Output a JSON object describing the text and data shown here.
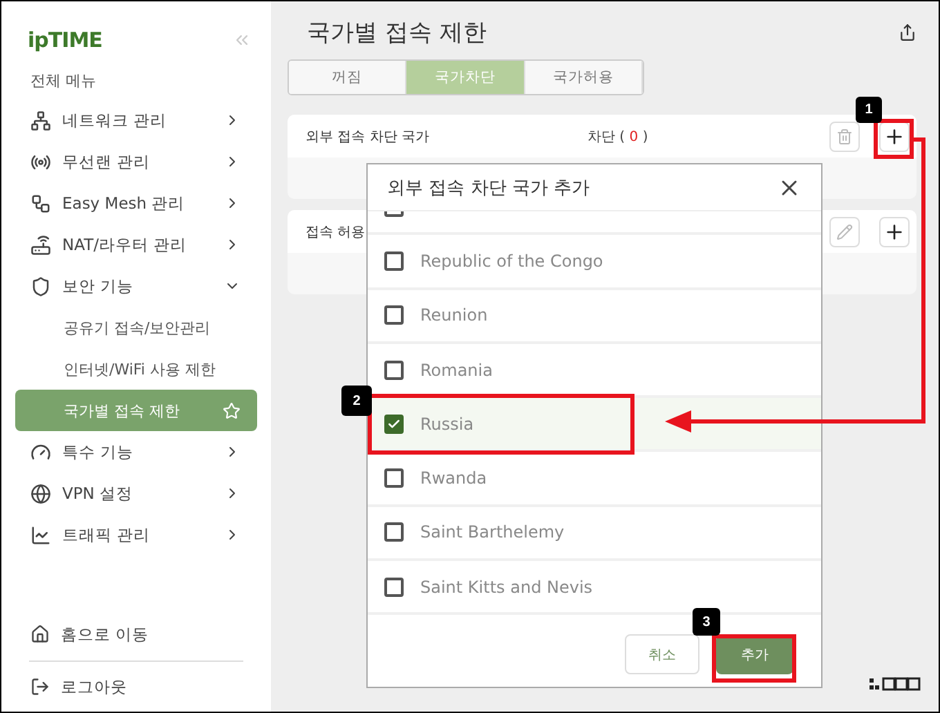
{
  "sidebar": {
    "logo": "ipTIME",
    "menu_title": "전체 메뉴",
    "items": [
      {
        "label": "네트워크 관리",
        "expanded": false
      },
      {
        "label": "무선랜 관리",
        "expanded": false
      },
      {
        "label": "Easy Mesh 관리",
        "expanded": false
      },
      {
        "label": "NAT/라우터 관리",
        "expanded": false
      },
      {
        "label": "보안 기능",
        "expanded": true,
        "children": [
          {
            "label": "공유기 접속/보안관리",
            "selected": false
          },
          {
            "label": "인터넷/WiFi 사용 제한",
            "selected": false
          },
          {
            "label": "국가별 접속 제한",
            "selected": true
          }
        ]
      },
      {
        "label": "특수 기능",
        "expanded": false
      },
      {
        "label": "VPN 설정",
        "expanded": false
      },
      {
        "label": "트래픽 관리",
        "expanded": false
      }
    ],
    "footer_links": [
      {
        "label": "홈으로 이동"
      },
      {
        "label": "로그아웃"
      }
    ]
  },
  "page": {
    "title": "국가별 접속 제한",
    "tabs": [
      {
        "label": "꺼짐",
        "selected": false
      },
      {
        "label": "국가차단",
        "selected": true
      },
      {
        "label": "국가허용",
        "selected": false
      }
    ],
    "cards": [
      {
        "label": "외부 접속 차단 국가",
        "status_prefix": "차단 (",
        "count": "0",
        "status_suffix": ")",
        "actions": [
          {
            "kind": "delete"
          },
          {
            "kind": "add"
          }
        ],
        "add_callout": "1"
      },
      {
        "label": "접속 허용",
        "actions": [
          {
            "kind": "edit"
          },
          {
            "kind": "add"
          }
        ]
      }
    ]
  },
  "dialog": {
    "title": "외부 접속 차단 국가 추가",
    "countries": [
      {
        "checked": false
      },
      {
        "label": "Republic of the Congo",
        "checked": false
      },
      {
        "label": "Reunion",
        "checked": false
      },
      {
        "label": "Romania",
        "checked": false
      },
      {
        "label": "Russia",
        "checked": true,
        "callout": "2"
      },
      {
        "label": "Rwanda",
        "checked": false
      },
      {
        "label": "Saint Barthelemy",
        "checked": false
      },
      {
        "label": "Saint Kitts and Nevis",
        "checked": false
      }
    ],
    "cancel": {
      "label": "취소"
    },
    "confirm": {
      "label": "추가",
      "callout": "3"
    }
  }
}
